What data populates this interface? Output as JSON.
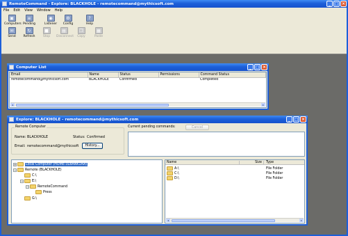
{
  "main_window": {
    "title": "RemoteCommand - Explore: BLACKHOLE - remotecommand@mythicsoft.com",
    "menu": [
      "File",
      "Edit",
      "View",
      "Window",
      "Help"
    ],
    "toolbar_row1": [
      {
        "label": "Computers",
        "icon": "computers-icon"
      },
      {
        "label": "Pending",
        "icon": "pending-icon"
      },
      {
        "label": "Listener",
        "icon": "listener-icon"
      },
      {
        "label": "Config",
        "icon": "config-icon"
      },
      {
        "label": "Help",
        "icon": "help-icon"
      }
    ],
    "toolbar_row2": [
      {
        "label": "Send",
        "icon": "send-icon",
        "enabled": true
      },
      {
        "label": "Refresh",
        "icon": "refresh-icon",
        "enabled": true
      },
      {
        "label": "Stop",
        "icon": "stop-icon",
        "enabled": false
      },
      {
        "label": "Disconnect",
        "icon": "disconnect-icon",
        "enabled": false
      },
      {
        "label": "Copy",
        "icon": "copy-icon",
        "enabled": false
      },
      {
        "label": "Paste",
        "icon": "paste-icon",
        "enabled": false
      }
    ]
  },
  "computer_list": {
    "title": "Computer List",
    "columns": [
      "Email",
      "Name",
      "Status",
      "Permissions",
      "Command Status"
    ],
    "rows": [
      [
        "remotecommand@mythicsoft.com",
        "BLACKHOLE",
        "Confirmed",
        "",
        "Completed"
      ]
    ]
  },
  "explore": {
    "title": "Explore: BLACKHOLE - remotecommand@mythicsoft.com",
    "remote_computer_label": "Remote Computer",
    "name_label": "Name:",
    "name_value": "BLACKHOLE",
    "status_label": "Status:",
    "status_value": "Confirmed",
    "email_label": "Email:",
    "email_value": "remotecommand@mythicsoft",
    "history_button": "History...",
    "pending_label": "Current pending commands:",
    "cancel_button": "Cancel",
    "tree": [
      {
        "label": "Local Computer (HOME-3LBANK1AA)",
        "selected": true
      },
      {
        "label": "Remote (BLACKHOLE)",
        "selected": false
      },
      {
        "label": "C:\\",
        "selected": false
      },
      {
        "label": "E:\\",
        "selected": false
      },
      {
        "label": "RemoteCommand",
        "selected": false
      },
      {
        "label": "Press",
        "selected": false
      },
      {
        "label": "G:\\",
        "selected": false
      }
    ],
    "list_columns": [
      "Name",
      "Size",
      "Type"
    ],
    "list_rows": [
      [
        "A:\\",
        "",
        "File Folder"
      ],
      [
        "C:\\",
        "",
        "File Folder"
      ],
      [
        "D:\\",
        "",
        "File Folder"
      ]
    ]
  },
  "colors": {
    "titlebar": "#1d5fd9",
    "window_bg": "#ece9d8",
    "desktop": "#6b6b68",
    "selection": "#316ac5"
  }
}
